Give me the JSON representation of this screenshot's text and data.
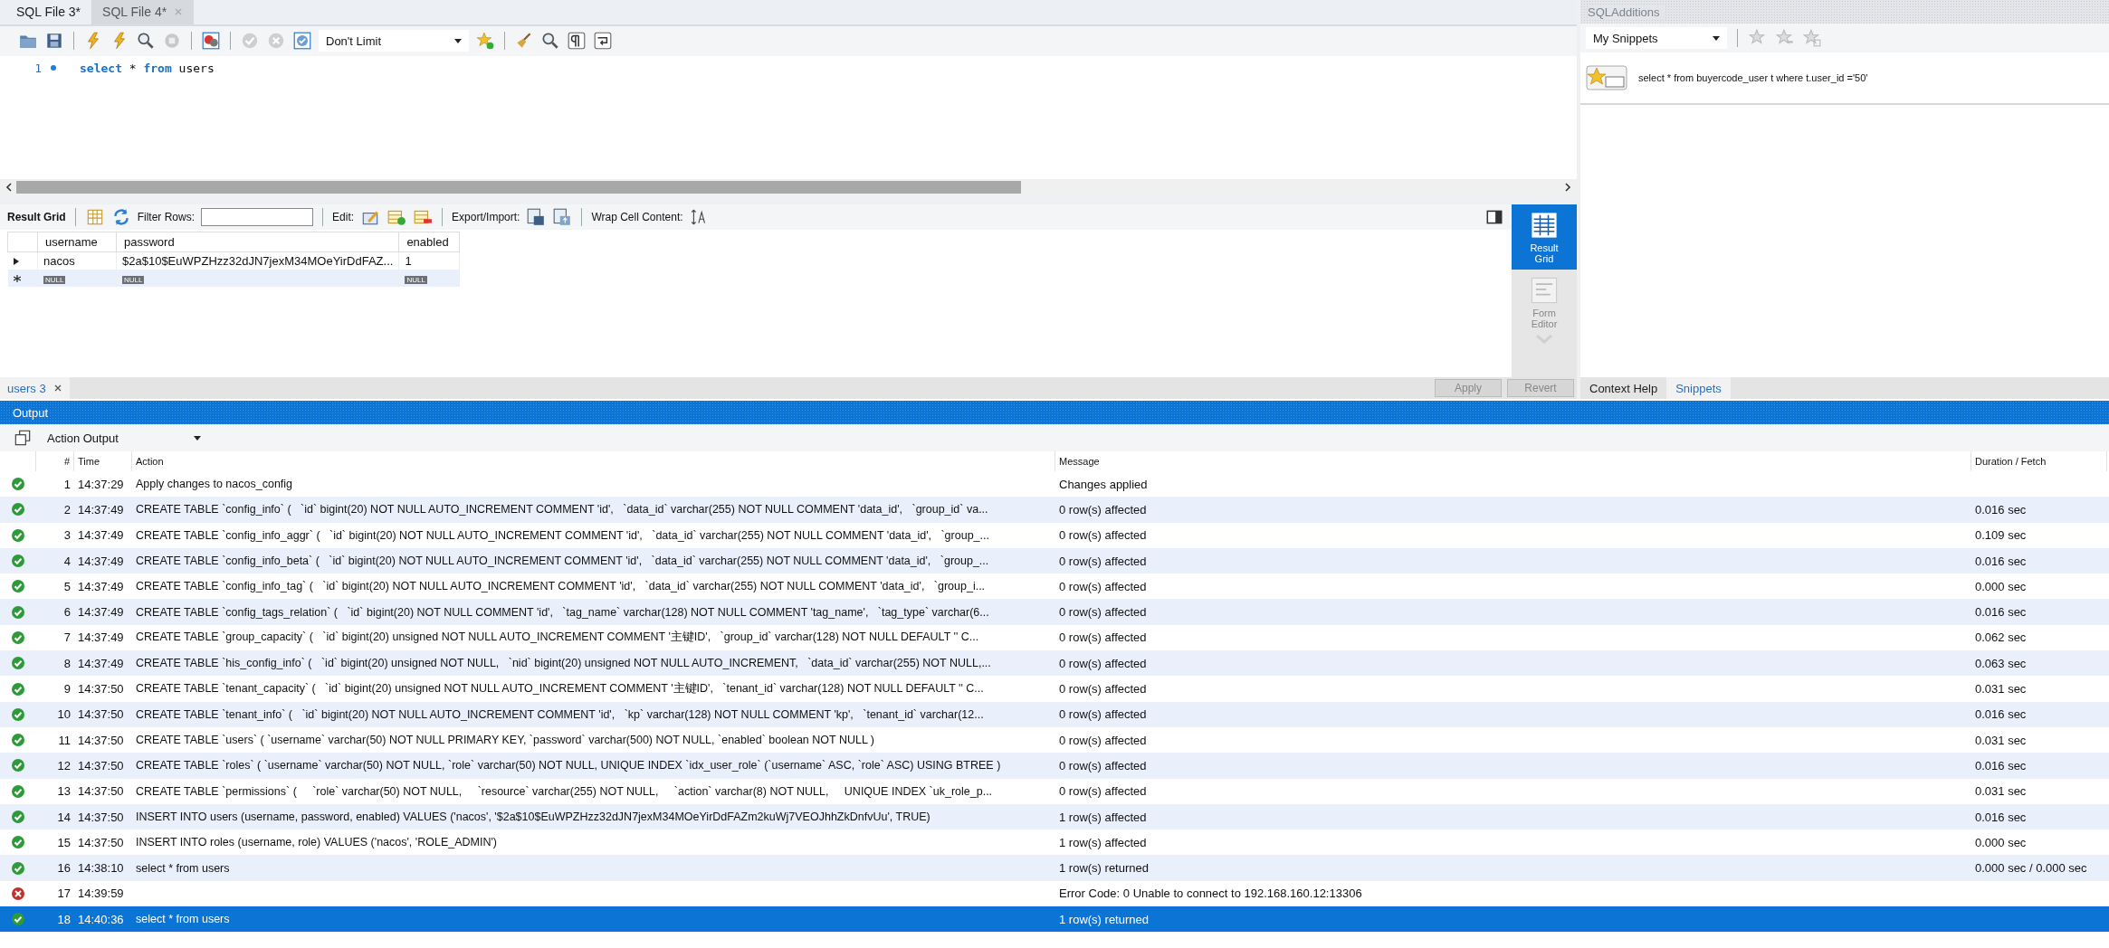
{
  "editor_tabs": [
    {
      "label": "SQL File 3*",
      "selected": true
    },
    {
      "label": "SQL File 4*",
      "selected": false
    }
  ],
  "limit_dropdown": {
    "value": "Don't Limit"
  },
  "editor": {
    "lines": [
      {
        "number": "1",
        "tokens": [
          {
            "text": "select",
            "kind": "keyword"
          },
          {
            "text": " * ",
            "kind": "plain"
          },
          {
            "text": "from",
            "kind": "keyword"
          },
          {
            "text": " users",
            "kind": "plain"
          }
        ]
      }
    ]
  },
  "result_toolbar": {
    "view_label": "Result Grid",
    "filter_label": "Filter Rows:",
    "edit_label": "Edit:",
    "export_label": "Export/Import:",
    "wrap_label": "Wrap Cell Content:"
  },
  "result_grid": {
    "columns": [
      "username",
      "password",
      "enabled"
    ],
    "rows": [
      {
        "cells": [
          "nacos",
          "$2a$10$EuWPZHzz32dJN7jexM34MOeYirDdFAZ...",
          "1"
        ]
      }
    ],
    "new_row": {
      "cells": [
        "NULL",
        "NULL",
        "NULL"
      ]
    }
  },
  "side_buttons": [
    {
      "label": "Result Grid",
      "selected": true
    },
    {
      "label": "Form Editor",
      "selected": false
    }
  ],
  "result_tabs": [
    {
      "label": "users 3",
      "selected": true
    }
  ],
  "action_buttons": [
    {
      "label": "Apply",
      "disabled": true
    },
    {
      "label": "Revert",
      "disabled": true
    }
  ],
  "right_panel": {
    "title": "SQLAdditions",
    "dropdown": "My Snippets",
    "snippets": [
      "select * from buyercode_user t where t.user_id ='50'"
    ],
    "tabs": [
      {
        "label": "Context Help",
        "selected": false
      },
      {
        "label": "Snippets",
        "selected": true
      }
    ]
  },
  "output": {
    "title": "Output",
    "dropdown": "Action Output",
    "columns": [
      "#",
      "Time",
      "Action",
      "Message",
      "Duration / Fetch"
    ],
    "rows": [
      {
        "number": "1",
        "time": "14:37:29",
        "action": "Apply changes to nacos_config",
        "message": "Changes applied",
        "kind": "success",
        "selected": false
      },
      {
        "number": "2",
        "time": "14:37:49",
        "action": "CREATE TABLE `config_info` (   `id` bigint(20) NOT NULL AUTO_INCREMENT COMMENT 'id',   `data_id` varchar(255) NOT NULL COMMENT 'data_id',   `group_id` va...",
        "message": "0 row(s) affected",
        "duration": "0.016 sec",
        "kind": "success",
        "selected": false
      },
      {
        "number": "3",
        "time": "14:37:49",
        "action": "CREATE TABLE `config_info_aggr` (   `id` bigint(20) NOT NULL AUTO_INCREMENT COMMENT 'id',   `data_id` varchar(255) NOT NULL COMMENT 'data_id',   `group_...",
        "message": "0 row(s) affected",
        "duration": "0.109 sec",
        "kind": "success",
        "selected": false
      },
      {
        "number": "4",
        "time": "14:37:49",
        "action": "CREATE TABLE `config_info_beta` (   `id` bigint(20) NOT NULL AUTO_INCREMENT COMMENT 'id',   `data_id` varchar(255) NOT NULL COMMENT 'data_id',   `group_...",
        "message": "0 row(s) affected",
        "duration": "0.016 sec",
        "kind": "success",
        "selected": false
      },
      {
        "number": "5",
        "time": "14:37:49",
        "action": "CREATE TABLE `config_info_tag` (   `id` bigint(20) NOT NULL AUTO_INCREMENT COMMENT 'id',   `data_id` varchar(255) NOT NULL COMMENT 'data_id',   `group_i...",
        "message": "0 row(s) affected",
        "duration": "0.000 sec",
        "kind": "success",
        "selected": false
      },
      {
        "number": "6",
        "time": "14:37:49",
        "action": "CREATE TABLE `config_tags_relation` (   `id` bigint(20) NOT NULL COMMENT 'id',   `tag_name` varchar(128) NOT NULL COMMENT 'tag_name',   `tag_type` varchar(6...",
        "message": "0 row(s) affected",
        "duration": "0.016 sec",
        "kind": "success",
        "selected": false
      },
      {
        "number": "7",
        "time": "14:37:49",
        "action": "CREATE TABLE `group_capacity` (   `id` bigint(20) unsigned NOT NULL AUTO_INCREMENT COMMENT '主键ID',   `group_id` varchar(128) NOT NULL DEFAULT '' C...",
        "message": "0 row(s) affected",
        "duration": "0.062 sec",
        "kind": "success",
        "selected": false
      },
      {
        "number": "8",
        "time": "14:37:49",
        "action": "CREATE TABLE `his_config_info` (   `id` bigint(20) unsigned NOT NULL,   `nid` bigint(20) unsigned NOT NULL AUTO_INCREMENT,   `data_id` varchar(255) NOT NULL,...",
        "message": "0 row(s) affected",
        "duration": "0.063 sec",
        "kind": "success",
        "selected": false
      },
      {
        "number": "9",
        "time": "14:37:50",
        "action": "CREATE TABLE `tenant_capacity` (   `id` bigint(20) unsigned NOT NULL AUTO_INCREMENT COMMENT '主键ID',   `tenant_id` varchar(128) NOT NULL DEFAULT '' C...",
        "message": "0 row(s) affected",
        "duration": "0.031 sec",
        "kind": "success",
        "selected": false
      },
      {
        "number": "10",
        "time": "14:37:50",
        "action": "CREATE TABLE `tenant_info` (   `id` bigint(20) NOT NULL AUTO_INCREMENT COMMENT 'id',   `kp` varchar(128) NOT NULL COMMENT 'kp',   `tenant_id` varchar(12...",
        "message": "0 row(s) affected",
        "duration": "0.016 sec",
        "kind": "success",
        "selected": false
      },
      {
        "number": "11",
        "time": "14:37:50",
        "action": "CREATE TABLE `users` ( `username` varchar(50) NOT NULL PRIMARY KEY, `password` varchar(500) NOT NULL, `enabled` boolean NOT NULL )",
        "message": "0 row(s) affected",
        "duration": "0.031 sec",
        "kind": "success",
        "selected": false
      },
      {
        "number": "12",
        "time": "14:37:50",
        "action": "CREATE TABLE `roles` ( `username` varchar(50) NOT NULL, `role` varchar(50) NOT NULL, UNIQUE INDEX `idx_user_role` (`username` ASC, `role` ASC) USING BTREE )",
        "message": "0 row(s) affected",
        "duration": "0.016 sec",
        "kind": "success",
        "selected": false
      },
      {
        "number": "13",
        "time": "14:37:50",
        "action": "CREATE TABLE `permissions` (     `role` varchar(50) NOT NULL,     `resource` varchar(255) NOT NULL,     `action` varchar(8) NOT NULL,     UNIQUE INDEX `uk_role_p...",
        "message": "0 row(s) affected",
        "duration": "0.031 sec",
        "kind": "success",
        "selected": false
      },
      {
        "number": "14",
        "time": "14:37:50",
        "action": "INSERT INTO users (username, password, enabled) VALUES ('nacos', '$2a$10$EuWPZHzz32dJN7jexM34MOeYirDdFAZm2kuWj7VEOJhhZkDnfvUu', TRUE)",
        "message": "1 row(s) affected",
        "duration": "0.016 sec",
        "kind": "success",
        "selected": false
      },
      {
        "number": "15",
        "time": "14:37:50",
        "action": "INSERT INTO roles (username, role) VALUES ('nacos', 'ROLE_ADMIN')",
        "message": "1 row(s) affected",
        "duration": "0.000 sec",
        "kind": "success",
        "selected": false
      },
      {
        "number": "16",
        "time": "14:38:10",
        "action": "select * from users",
        "message": "1 row(s) returned",
        "duration": "0.000 sec / 0.000 sec",
        "kind": "success",
        "selected": false
      },
      {
        "number": "17",
        "time": "14:39:59",
        "message": "Error Code: 0 Unable to connect to 192.168.160.12:13306",
        "kind": "error",
        "selected": false
      },
      {
        "number": "18",
        "time": "14:40:36",
        "action": "select * from users",
        "message": "1 row(s) returned",
        "kind": "success",
        "selected": true
      }
    ]
  }
}
